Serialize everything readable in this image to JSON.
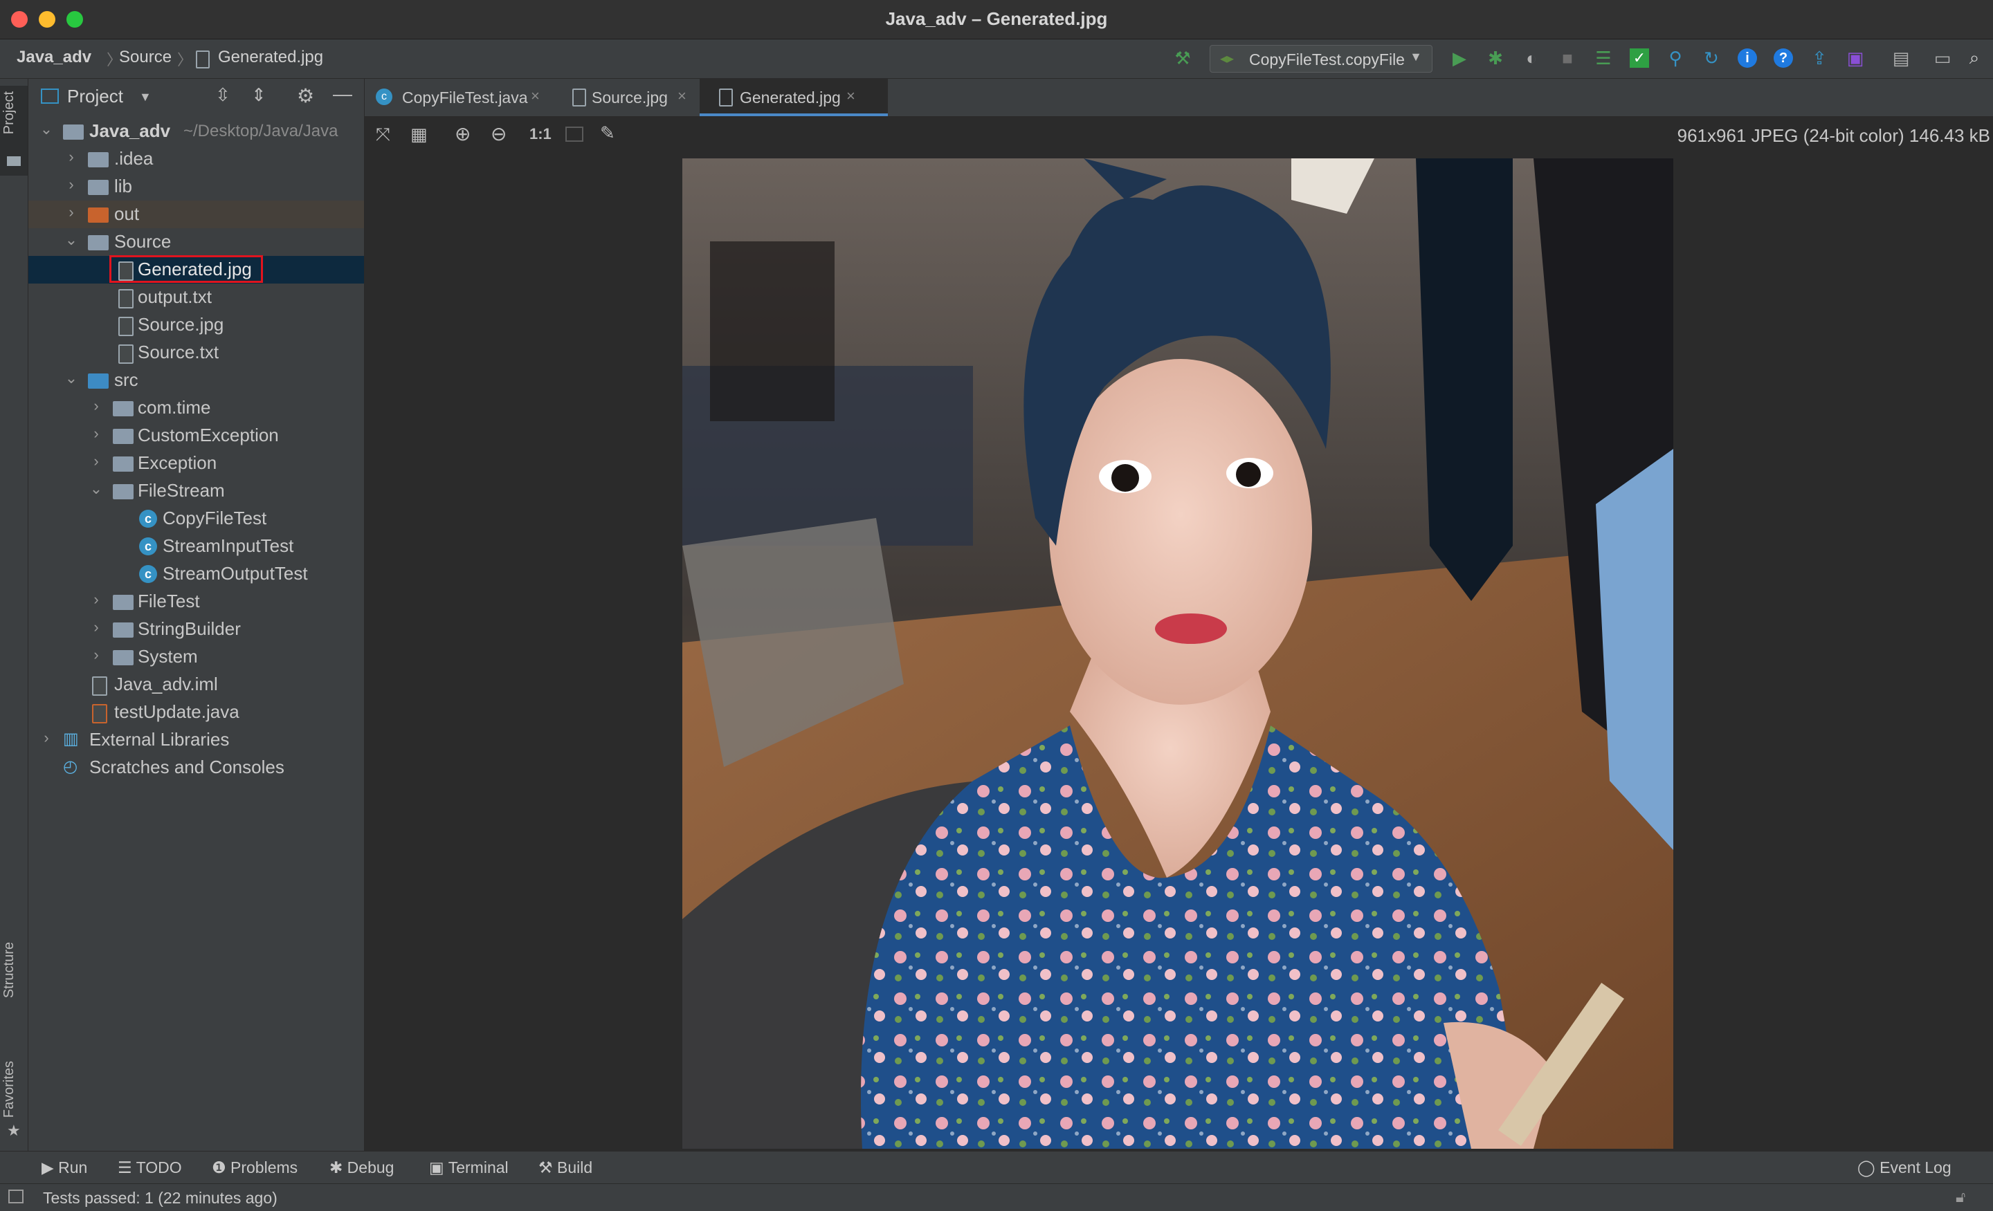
{
  "window": {
    "title": "Java_adv – Generated.jpg"
  },
  "breadcrumb": [
    "Java_adv",
    "Source",
    "Generated.jpg"
  ],
  "run_config": {
    "label": "CopyFileTest.copyFile"
  },
  "left_strip": {
    "project": "Project",
    "structure": "Structure",
    "favorites": "Favorites"
  },
  "project_panel": {
    "title": "Project",
    "root_label": "Java_adv",
    "root_path": "~/Desktop/Java/Java",
    "tree": [
      {
        "label": ".idea"
      },
      {
        "label": "lib"
      },
      {
        "label": "out"
      },
      {
        "label": "Source"
      },
      {
        "label": "Generated.jpg"
      },
      {
        "label": "output.txt"
      },
      {
        "label": "Source.jpg"
      },
      {
        "label": "Source.txt"
      },
      {
        "label": "src"
      },
      {
        "label": "com.time"
      },
      {
        "label": "CustomException"
      },
      {
        "label": "Exception"
      },
      {
        "label": "FileStream"
      },
      {
        "label": "CopyFileTest"
      },
      {
        "label": "StreamInputTest"
      },
      {
        "label": "StreamOutputTest"
      },
      {
        "label": "FileTest"
      },
      {
        "label": "StringBuilder"
      },
      {
        "label": "System"
      },
      {
        "label": "Java_adv.iml"
      },
      {
        "label": "testUpdate.java"
      },
      {
        "label": "External Libraries"
      },
      {
        "label": "Scratches and Consoles"
      }
    ]
  },
  "editor_tabs": [
    {
      "label": "CopyFileTest.java"
    },
    {
      "label": "Source.jpg"
    },
    {
      "label": "Generated.jpg"
    }
  ],
  "image_viewer": {
    "info": "961x961 JPEG (24-bit color) 146.43 kB",
    "zoom_actual": "1:1"
  },
  "bottom_tabs": [
    {
      "label": "Run"
    },
    {
      "label": "TODO"
    },
    {
      "label": "Problems"
    },
    {
      "label": "Debug"
    },
    {
      "label": "Terminal"
    },
    {
      "label": "Build"
    }
  ],
  "event_log": "Event Log",
  "status": {
    "message": "Tests passed: 1 (22 minutes ago)"
  },
  "colors": {
    "accent": "#3592c4",
    "selection": "#0d293e",
    "highlight_box": "#e0141e",
    "run_green": "#499c54"
  }
}
